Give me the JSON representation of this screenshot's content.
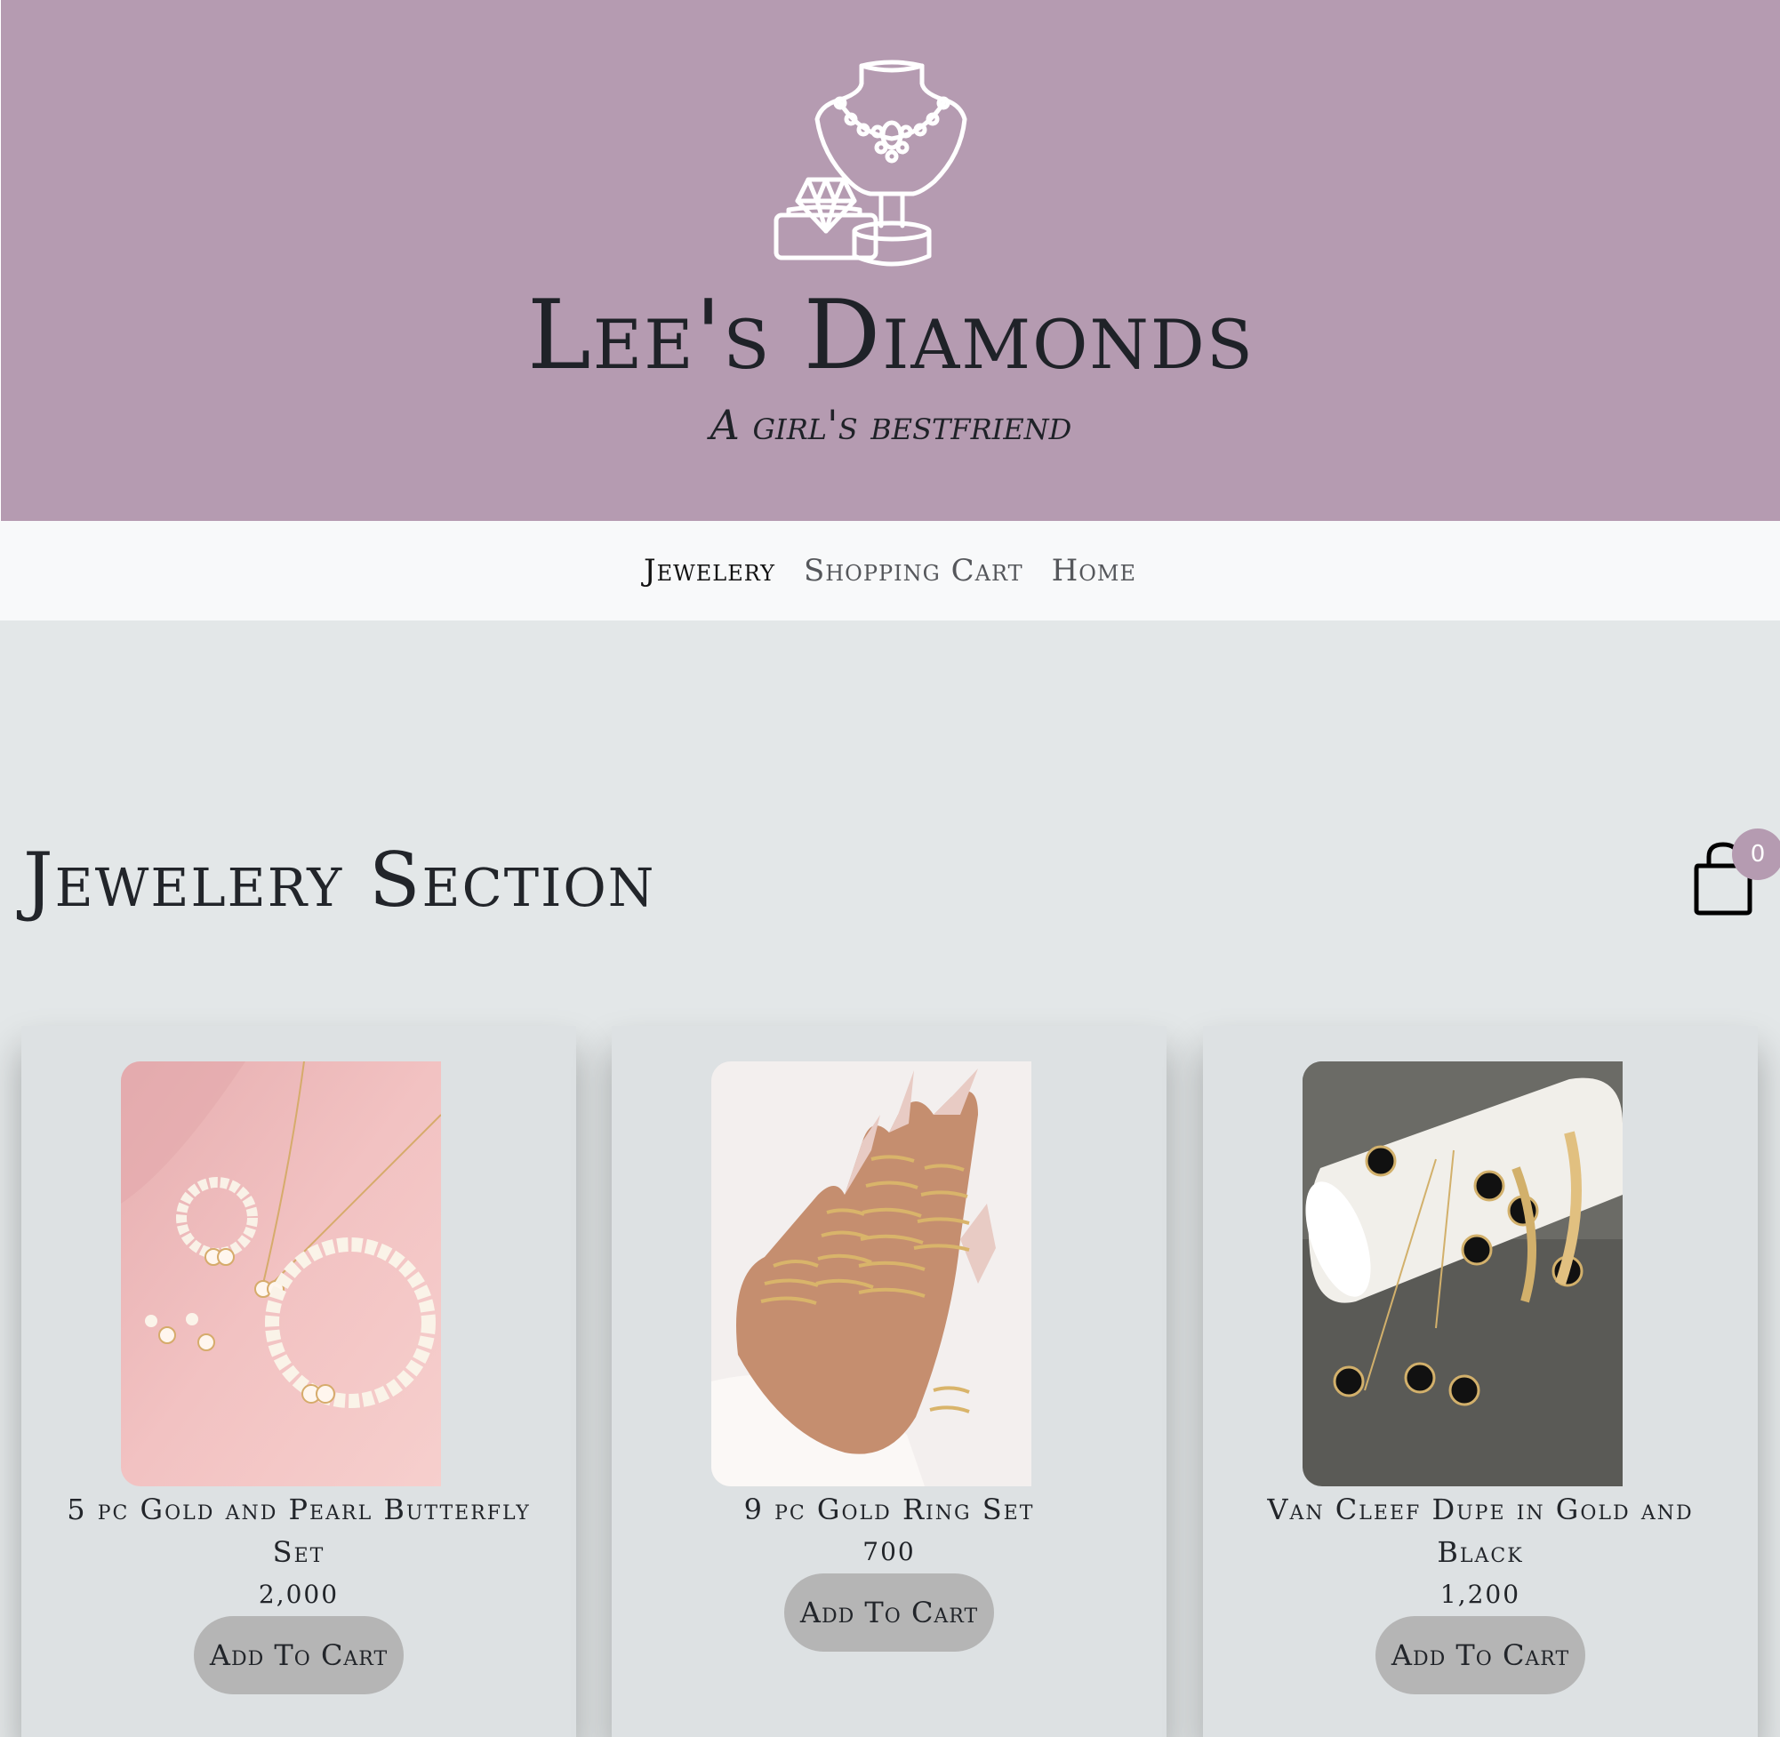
{
  "brand": {
    "title": "Lee's Diamonds",
    "tagline": "A girl's bestfriend",
    "logo_icon": "jewelry-bust-ring-box-icon"
  },
  "nav": {
    "items": [
      {
        "label": "Jewelery",
        "active": true
      },
      {
        "label": "Shopping Cart",
        "active": false
      },
      {
        "label": "Home",
        "active": false
      }
    ]
  },
  "section": {
    "title": "Jewelery Section"
  },
  "cart": {
    "icon": "shopping-bag-icon",
    "count": "0"
  },
  "products": [
    {
      "name": "5 pc Gold and Pearl Butterfly Set",
      "price": "2,000",
      "button": "Add To Cart",
      "image": "pearl-butterfly-set-photo"
    },
    {
      "name": "9 pc Gold Ring Set",
      "price": "700",
      "button": "Add To Cart",
      "image": "gold-ring-set-photo"
    },
    {
      "name": "Van Cleef Dupe in Gold and Black",
      "price": "1,200",
      "button": "Add To Cart",
      "image": "van-cleef-dupe-photo"
    }
  ],
  "colors": {
    "hero_bg": "#b59bb1",
    "nav_bg": "#f8f9fa",
    "page_bg": "#e3e7e8",
    "card_bg": "#dde1e3",
    "button_bg": "#b5b5b5",
    "badge_bg": "#b59bb1"
  }
}
